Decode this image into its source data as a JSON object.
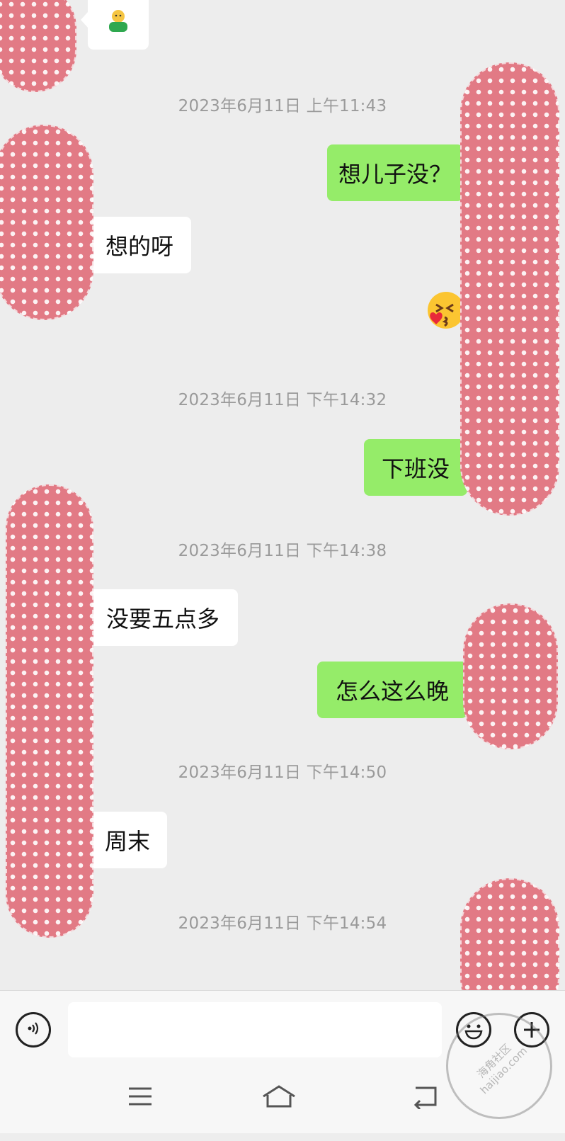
{
  "timestamps": [
    "2023年6月11日 上午11:43",
    "2023年6月11日 下午14:32",
    "2023年6月11日 下午14:38",
    "2023年6月11日 下午14:50",
    "2023年6月11日 下午14:54"
  ],
  "messages": [
    {
      "side": "sent",
      "text": "想儿子没？"
    },
    {
      "side": "received",
      "text": "想的呀"
    },
    {
      "side": "sent",
      "text": "下班没"
    },
    {
      "side": "received",
      "text": "没要五点多"
    },
    {
      "side": "sent",
      "text": "怎么这么晚"
    },
    {
      "side": "received",
      "text": "周末"
    }
  ],
  "stickers": [
    {
      "side": "received",
      "icon": "green-figure-sticker-icon"
    },
    {
      "side": "sent",
      "icon": "kiss-heart-emoji-icon"
    }
  ],
  "input": {
    "value": "",
    "placeholder": ""
  },
  "colors": {
    "background": "#ededed",
    "sent_bubble": "#95ec69",
    "received_bubble": "#ffffff",
    "redaction": "#e27a85",
    "timestamp": "#9a9a9a"
  },
  "watermark": {
    "line1": "海角社区",
    "line2": "haijiao.com"
  }
}
